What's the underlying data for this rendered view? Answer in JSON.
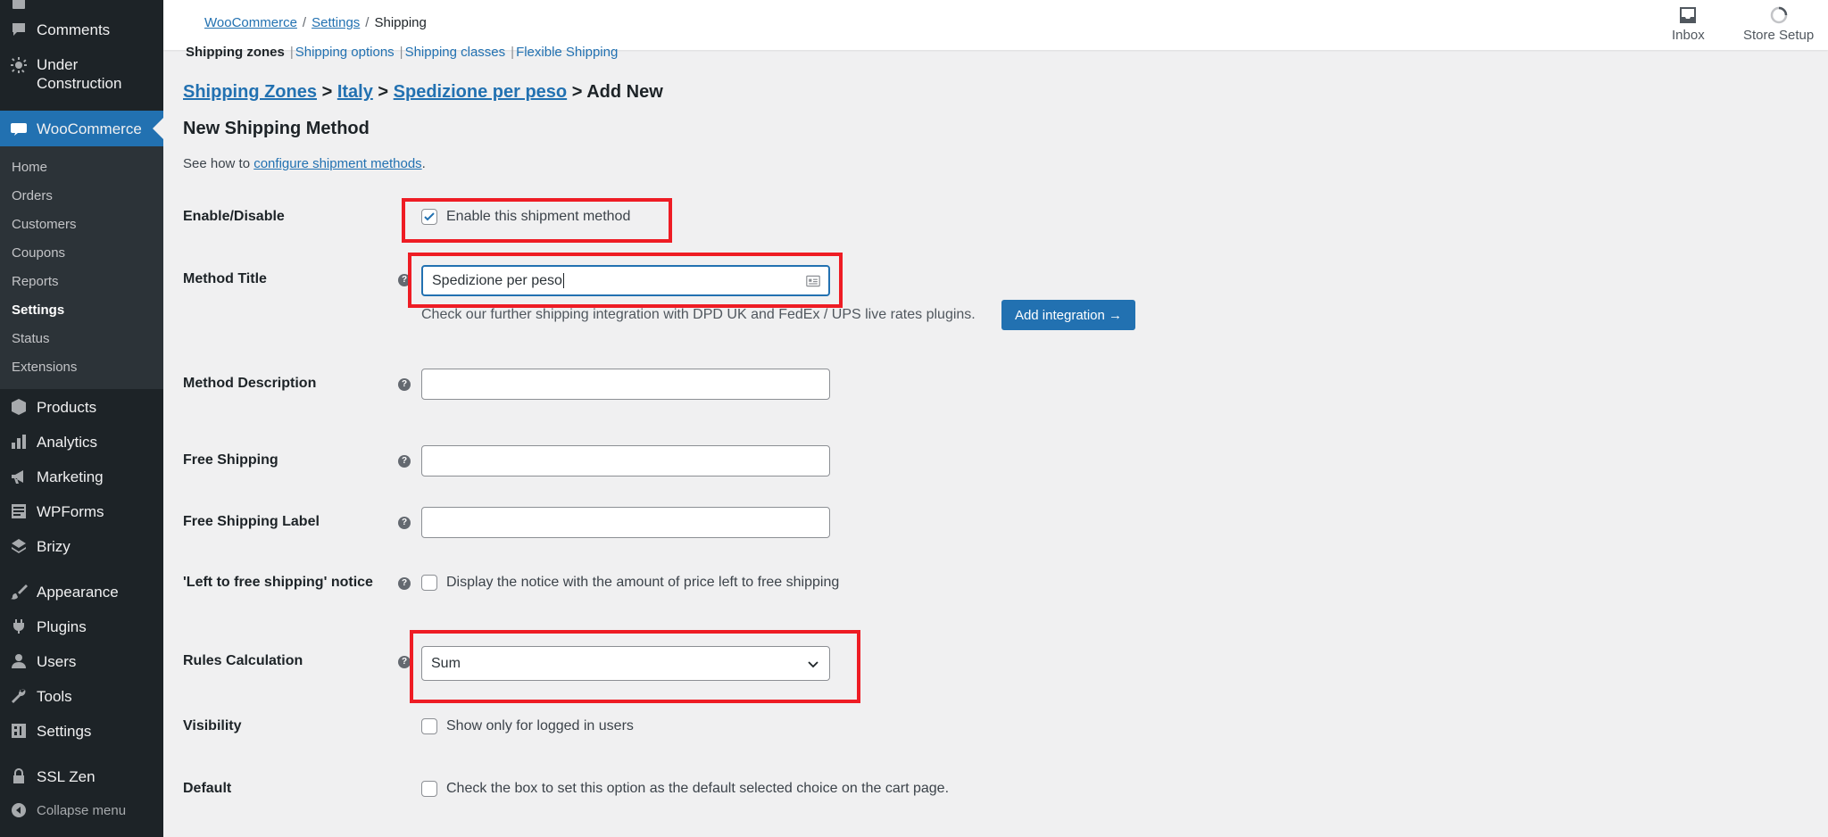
{
  "sidebar": {
    "top_items": [
      {
        "label": "Comments",
        "icon": "comment-icon"
      },
      {
        "label": "Under Construction",
        "icon": "gear-icon"
      }
    ],
    "woocommerce": {
      "label": "WooCommerce",
      "icon": "woo-icon"
    },
    "submenu": [
      "Home",
      "Orders",
      "Customers",
      "Coupons",
      "Reports",
      "Settings",
      "Status",
      "Extensions"
    ],
    "current_submenu": "Settings",
    "bottom_items": [
      {
        "label": "Products",
        "icon": "box-icon"
      },
      {
        "label": "Analytics",
        "icon": "chart-icon"
      },
      {
        "label": "Marketing",
        "icon": "megaphone-icon"
      },
      {
        "label": "WPForms",
        "icon": "form-icon"
      },
      {
        "label": "Brizy",
        "icon": "layers-icon"
      },
      {
        "label": "Appearance",
        "icon": "brush-icon"
      },
      {
        "label": "Plugins",
        "icon": "plug-icon"
      },
      {
        "label": "Users",
        "icon": "user-icon"
      },
      {
        "label": "Tools",
        "icon": "wrench-icon"
      },
      {
        "label": "Settings",
        "icon": "settings-icon"
      },
      {
        "label": "SSL Zen",
        "icon": "lock-icon"
      }
    ],
    "collapse_label": "Collapse menu"
  },
  "topbar": {
    "breadcrumb": [
      "WooCommerce",
      "Settings",
      "Shipping"
    ],
    "inbox_label": "Inbox",
    "store_setup_label": "Store Setup"
  },
  "subnav": {
    "items": [
      "Shipping zones",
      "Shipping options",
      "Shipping classes",
      "Flexible Shipping"
    ]
  },
  "heading": {
    "crumbs": [
      "Shipping Zones",
      "Italy",
      "Spedizione per peso"
    ],
    "sep": ">",
    "current": "Add New",
    "title": "New Shipping Method",
    "intro_prefix": "See how to ",
    "intro_link": "configure shipment methods",
    "intro_suffix": "."
  },
  "form": {
    "enable": {
      "label": "Enable/Disable",
      "checkbox_label": "Enable this shipment method",
      "checked": true
    },
    "method_title": {
      "label": "Method Title",
      "value": "Spedizione per peso"
    },
    "integration_hint": "Check our further shipping integration with DPD UK and FedEx / UPS live rates plugins.",
    "add_integration_button": "Add integration →",
    "method_description": {
      "label": "Method Description",
      "value": ""
    },
    "free_shipping": {
      "label": "Free Shipping",
      "value": ""
    },
    "free_shipping_label": {
      "label": "Free Shipping Label",
      "value": ""
    },
    "left_notice": {
      "label": "'Left to free shipping' notice",
      "checkbox_label": "Display the notice with the amount of price left to free shipping"
    },
    "rules_calculation": {
      "label": "Rules Calculation",
      "value": "Sum"
    },
    "visibility": {
      "label": "Visibility",
      "checkbox_label": "Show only for logged in users"
    },
    "default": {
      "label": "Default",
      "checkbox_label": "Check the box to set this option as the default selected choice on the cart page."
    }
  },
  "colors": {
    "accent": "#2271b1",
    "highlight": "#ee1c24",
    "sidebar": "#1d2327"
  }
}
